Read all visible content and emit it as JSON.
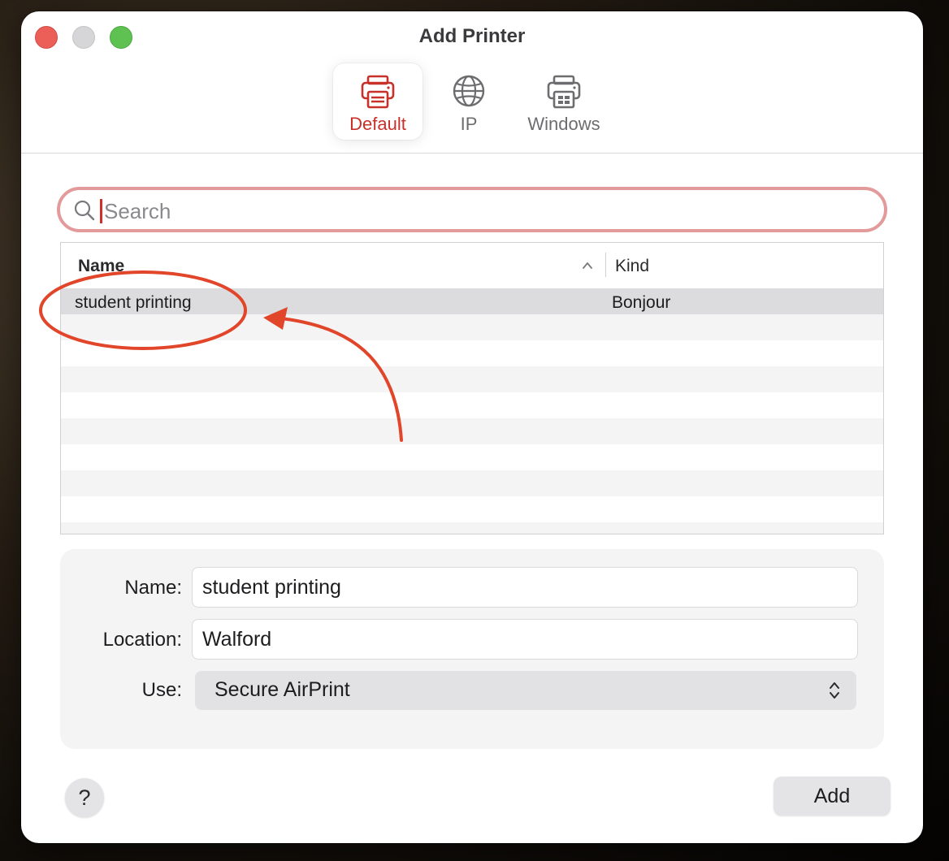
{
  "window": {
    "title": "Add Printer"
  },
  "toolbar": {
    "tabs": [
      {
        "label": "Default",
        "icon": "printer-icon",
        "selected": true
      },
      {
        "label": "IP",
        "icon": "globe-icon",
        "selected": false
      },
      {
        "label": "Windows",
        "icon": "windows-printer-icon",
        "selected": false
      }
    ]
  },
  "search": {
    "placeholder": "Search",
    "value": ""
  },
  "table": {
    "columns": {
      "name": "Name",
      "kind": "Kind"
    },
    "sort": "ascending",
    "rows": [
      {
        "name": "student printing",
        "kind": "Bonjour",
        "selected": true
      }
    ]
  },
  "form": {
    "name_label": "Name:",
    "name_value": "student printing",
    "location_label": "Location:",
    "location_value": "Walford",
    "use_label": "Use:",
    "use_value": "Secure AirPrint"
  },
  "footer": {
    "help_label": "?",
    "add_label": "Add"
  },
  "colors": {
    "accent": "#c8312a",
    "search_focus_ring": "#e39a9a",
    "annotation": "#e1452a",
    "selected_row": "#dcdcde"
  }
}
